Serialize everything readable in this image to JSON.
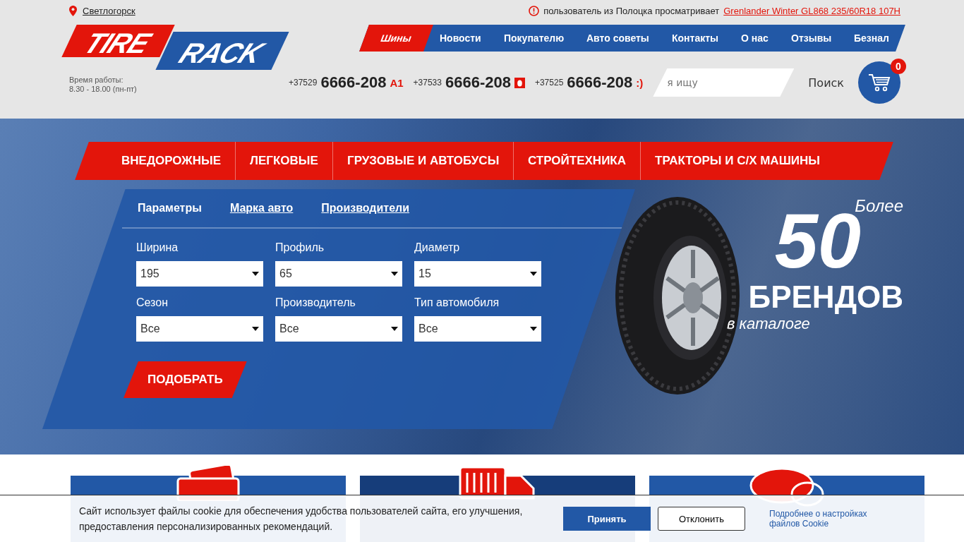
{
  "header": {
    "city": "Светлогорск",
    "logo": {
      "word_1": "TIRE",
      "word_2": "RACK"
    },
    "hours_label": "Время работы:",
    "hours": "8.30 - 18.00 (пн-пт)",
    "viewer_notice": "пользователь из Полоцка просматривает",
    "viewer_link": "Grenlander Winter GL868 235/60R18 107H"
  },
  "nav": [
    {
      "label": "Шины",
      "selected": true
    },
    {
      "label": "Новости",
      "selected": false
    },
    {
      "label": "Покупателю",
      "selected": false
    },
    {
      "label": "Авто советы",
      "selected": false
    },
    {
      "label": "Контакты",
      "selected": false
    },
    {
      "label": "О нас",
      "selected": false
    },
    {
      "label": "Отзывы",
      "selected": false
    },
    {
      "label": "Безнал",
      "selected": false
    }
  ],
  "phones": [
    {
      "code": "+37529",
      "number": "6666-208",
      "kind": "a1",
      "badge": "A1"
    },
    {
      "code": "+37533",
      "number": "6666-208",
      "kind": "mts"
    },
    {
      "code": "+37525",
      "number": "6666-208",
      "kind": "life",
      "badge": ":)"
    }
  ],
  "search": {
    "placeholder": "я ищу",
    "button": "Поиск"
  },
  "cart": {
    "count": "0"
  },
  "categories": [
    "ВНЕДОРОЖНЫЕ",
    "ЛЕГКОВЫЕ",
    "ГРУЗОВЫЕ И АВТОБУСЫ",
    "СТРОЙТЕХНИКА",
    "ТРАКТОРЫ И С/Х МАШИНЫ"
  ],
  "filter": {
    "tabs": [
      {
        "label": "Параметры",
        "selected": true
      },
      {
        "label": "Марка авто",
        "selected": false
      },
      {
        "label": "Производители",
        "selected": false
      }
    ],
    "fields": [
      {
        "label": "Ширина",
        "value": "195"
      },
      {
        "label": "Профиль",
        "value": "65"
      },
      {
        "label": "Диаметр",
        "value": "15"
      },
      {
        "label": "Сезон",
        "value": "Все"
      },
      {
        "label": "Производитель",
        "value": "Все"
      },
      {
        "label": "Тип автомобиля",
        "value": "Все"
      }
    ],
    "submit": "ПОДОБРАТЬ"
  },
  "promo": {
    "prefix": "Более",
    "number": "50",
    "title": "БРЕНДОВ",
    "subtitle": "в каталоге"
  },
  "cookie": {
    "text": "Сайт использует файлы cookie для обеспечения удобства пользователей сайта, его улучшения, предоставления персонализированных рекомендаций.",
    "accept": "Принять",
    "decline": "Отклонить",
    "link": "Подробнее о настройках файлов Cookie"
  }
}
